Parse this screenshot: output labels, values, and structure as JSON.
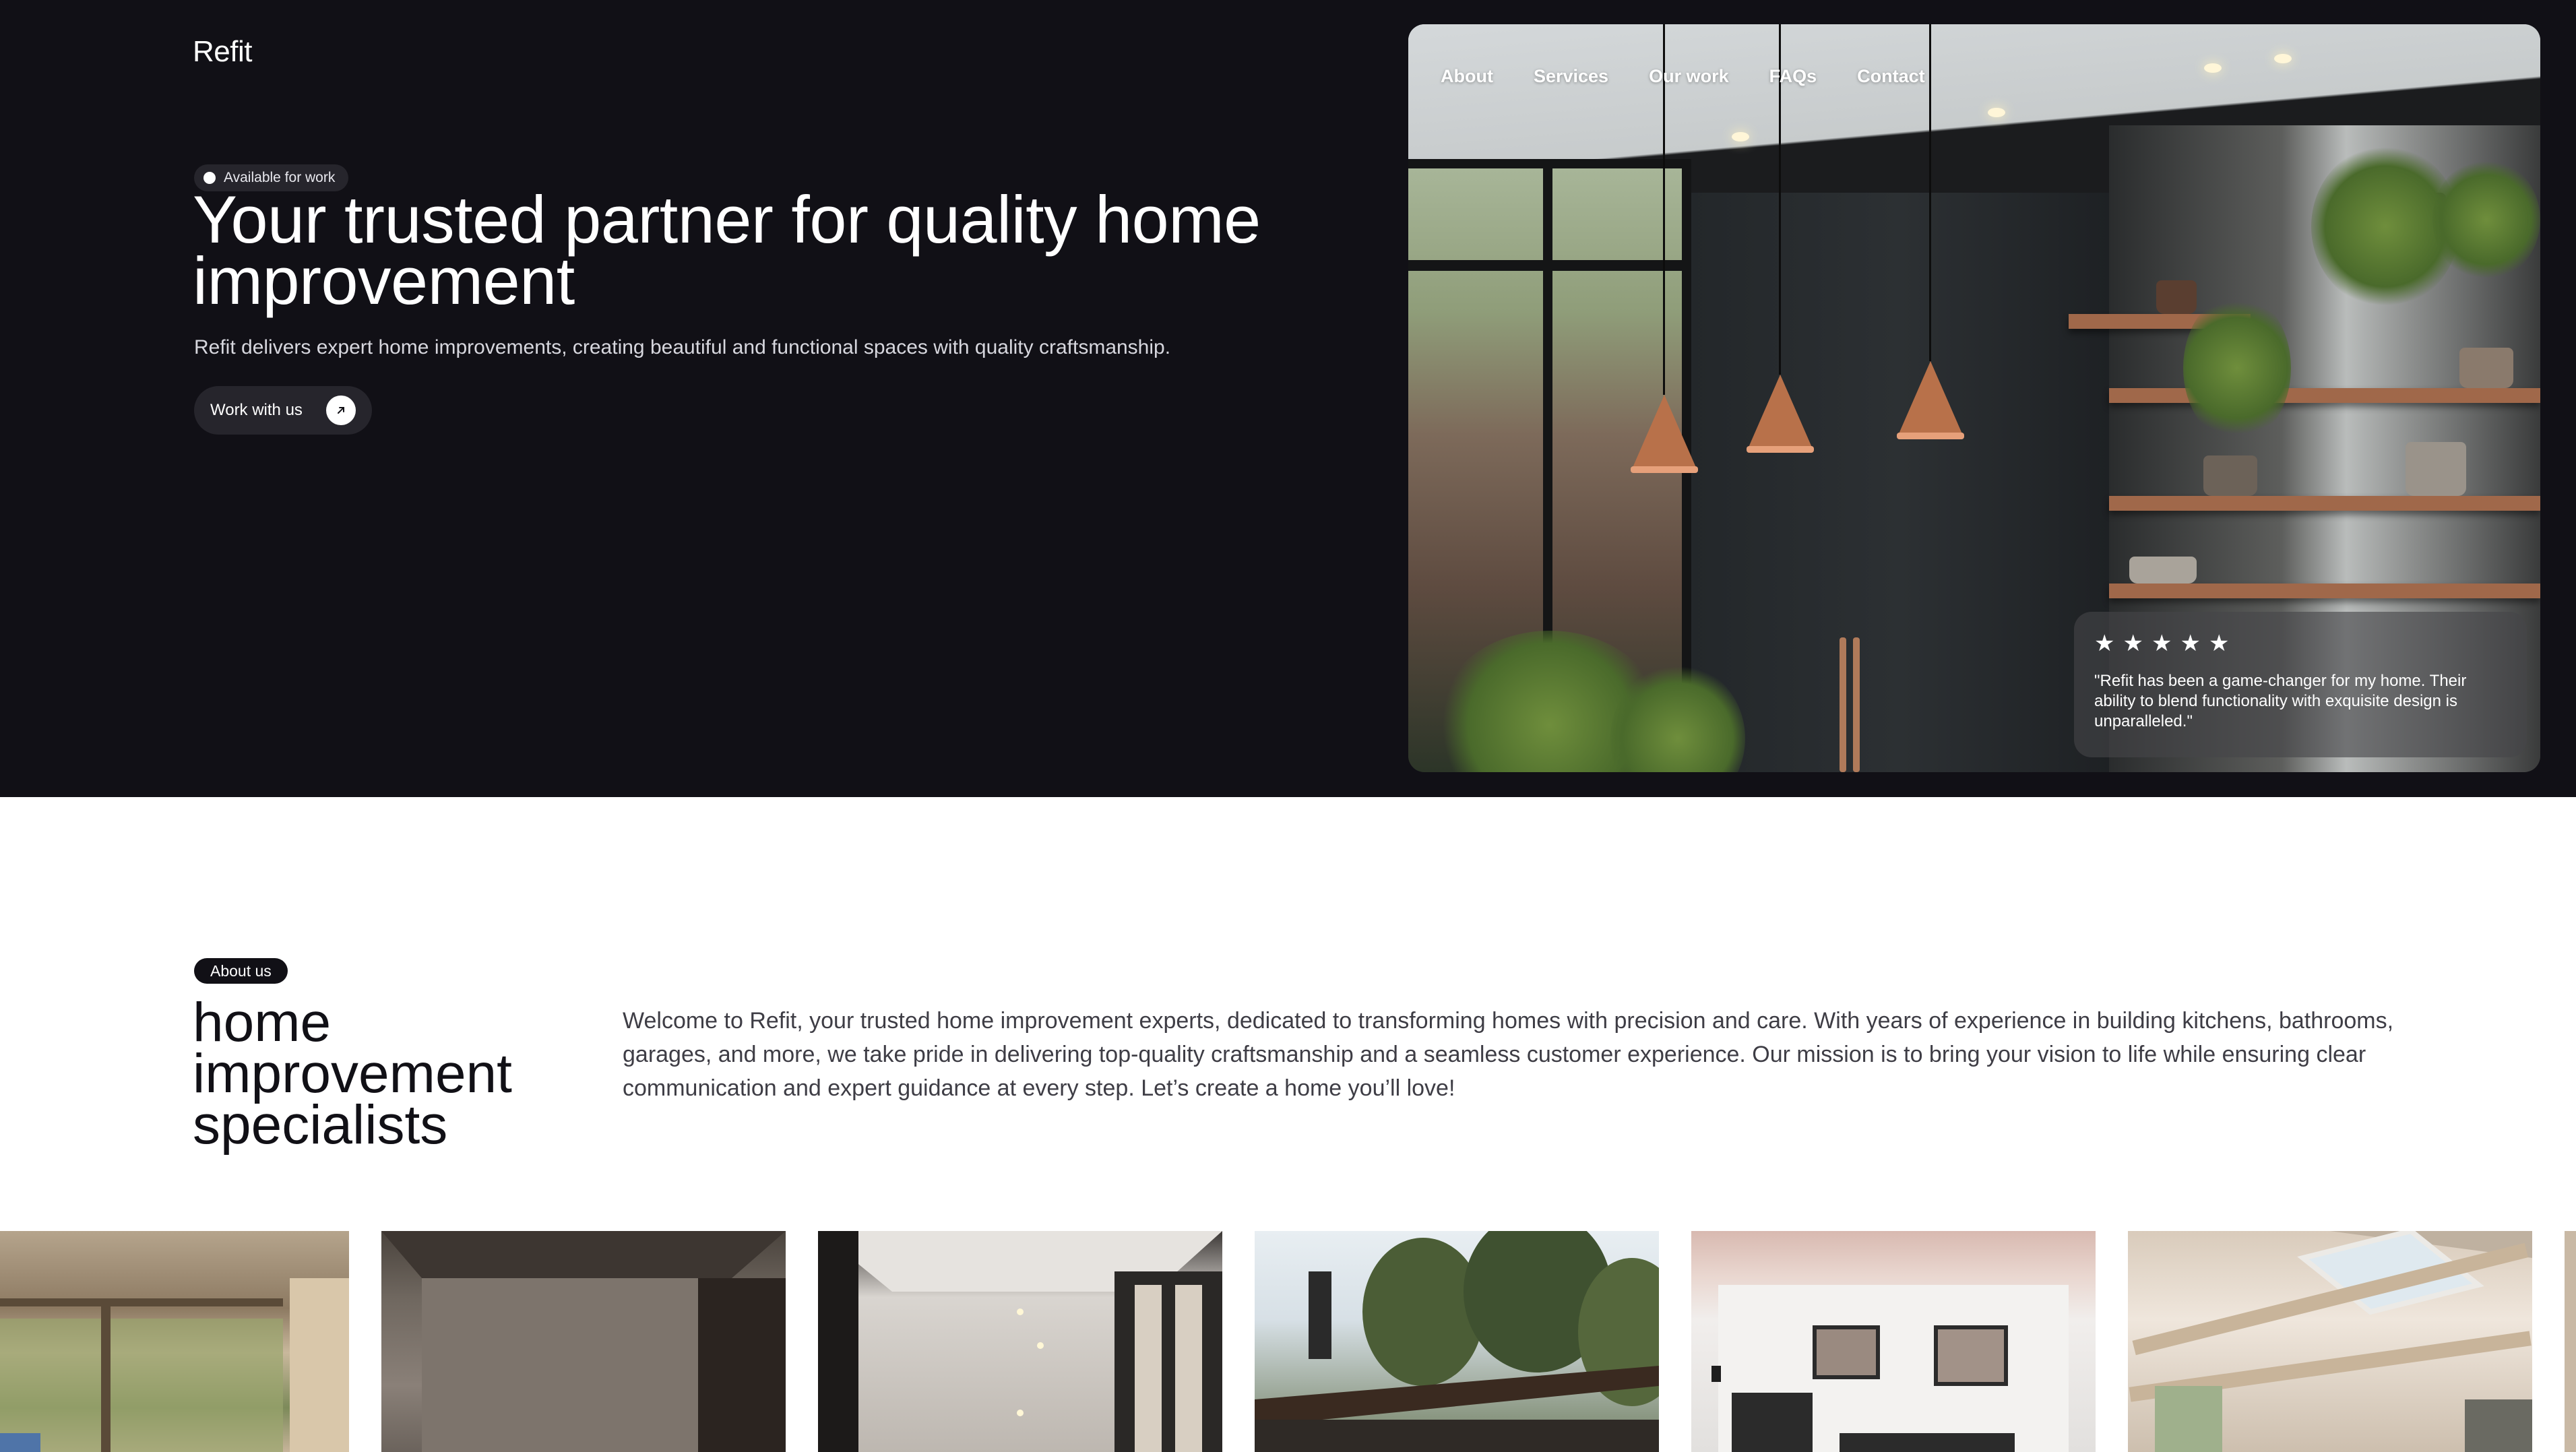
{
  "brand": {
    "logo": "Refit"
  },
  "hero": {
    "badge": "Available for work",
    "title": "Your trusted partner for quality home improvement",
    "subtitle": "Refit delivers expert home improvements, creating beautiful and functional spaces with quality craftsmanship.",
    "cta_label": "Work with us"
  },
  "nav": {
    "items": [
      "About",
      "Services",
      "Our work",
      "FAQs",
      "Contact"
    ]
  },
  "review": {
    "stars": 5,
    "star_glyph": "★",
    "quote": "\"Refit has been a game-changer for my home. Their ability to blend functionality with exquisite design is unparalleled.\""
  },
  "about": {
    "badge": "About us",
    "title": "home improvement specialists",
    "body": "Welcome to Refit, your trusted home improvement experts, dedicated to transforming homes with precision and care. With years of experience in building kitchens, bathrooms, garages, and more, we take pride in delivering top-quality craftsmanship and a seamless customer experience. Our mission is to bring your vision to life while ensuring clear communication and expert guidance at every step. Let’s create a home you’ll love!"
  },
  "gallery": {
    "images": [
      "living-room-photo",
      "concrete-room-photo",
      "hallway-photo",
      "modern-house-forest-photo",
      "white-house-photo",
      "attic-room-photo"
    ]
  },
  "colors": {
    "hero_bg": "#111016",
    "accent_copper": "#b8714a",
    "text_light": "#ffffff",
    "text_dark": "#111016"
  }
}
